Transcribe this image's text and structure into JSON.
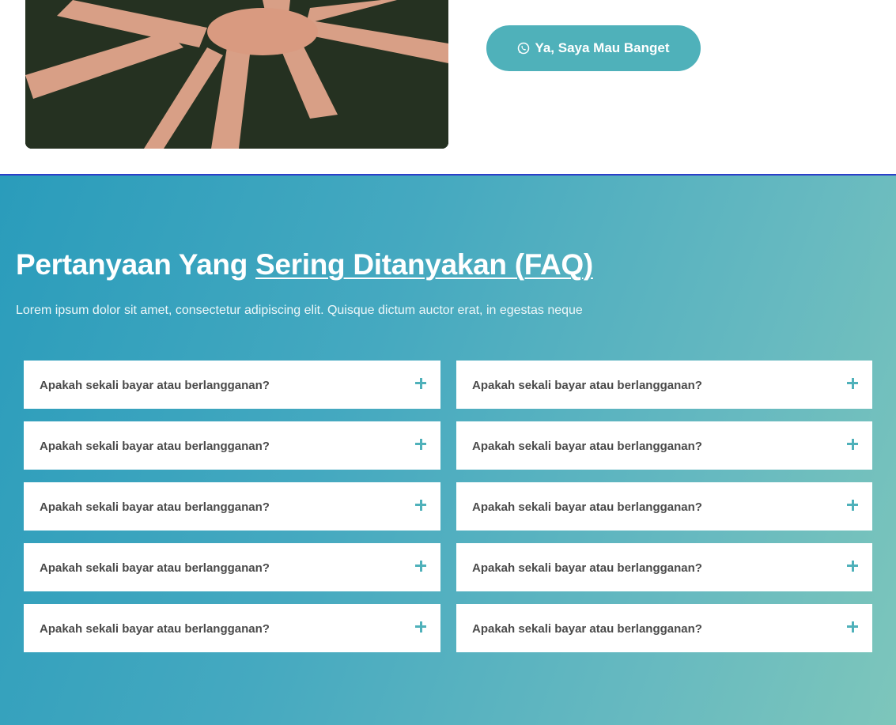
{
  "hero": {
    "cta_label": "Ya, Saya Mau Banget",
    "cta_icon": "whatsapp-icon",
    "brand_color": "#4fb1ba"
  },
  "faq": {
    "title_prefix": "Pertanyaan Yang ",
    "title_highlight": "Sering Ditanyakan (FAQ)",
    "subtitle": "Lorem ipsum dolor sit amet, consectetur adipiscing elit. Quisque dictum auctor erat, in egestas neque",
    "expand_icon": "plus-icon",
    "left_column": [
      {
        "question": "Apakah sekali bayar atau berlangganan?"
      },
      {
        "question": "Apakah sekali bayar atau berlangganan?"
      },
      {
        "question": "Apakah sekali bayar atau berlangganan?"
      },
      {
        "question": "Apakah sekali bayar atau berlangganan?"
      },
      {
        "question": "Apakah sekali bayar atau berlangganan?"
      }
    ],
    "right_column": [
      {
        "question": "Apakah sekali bayar atau berlangganan?"
      },
      {
        "question": "Apakah sekali bayar atau berlangganan?"
      },
      {
        "question": "Apakah sekali bayar atau berlangganan?"
      },
      {
        "question": "Apakah sekali bayar atau berlangganan?"
      },
      {
        "question": "Apakah sekali bayar atau berlangganan?"
      }
    ]
  }
}
